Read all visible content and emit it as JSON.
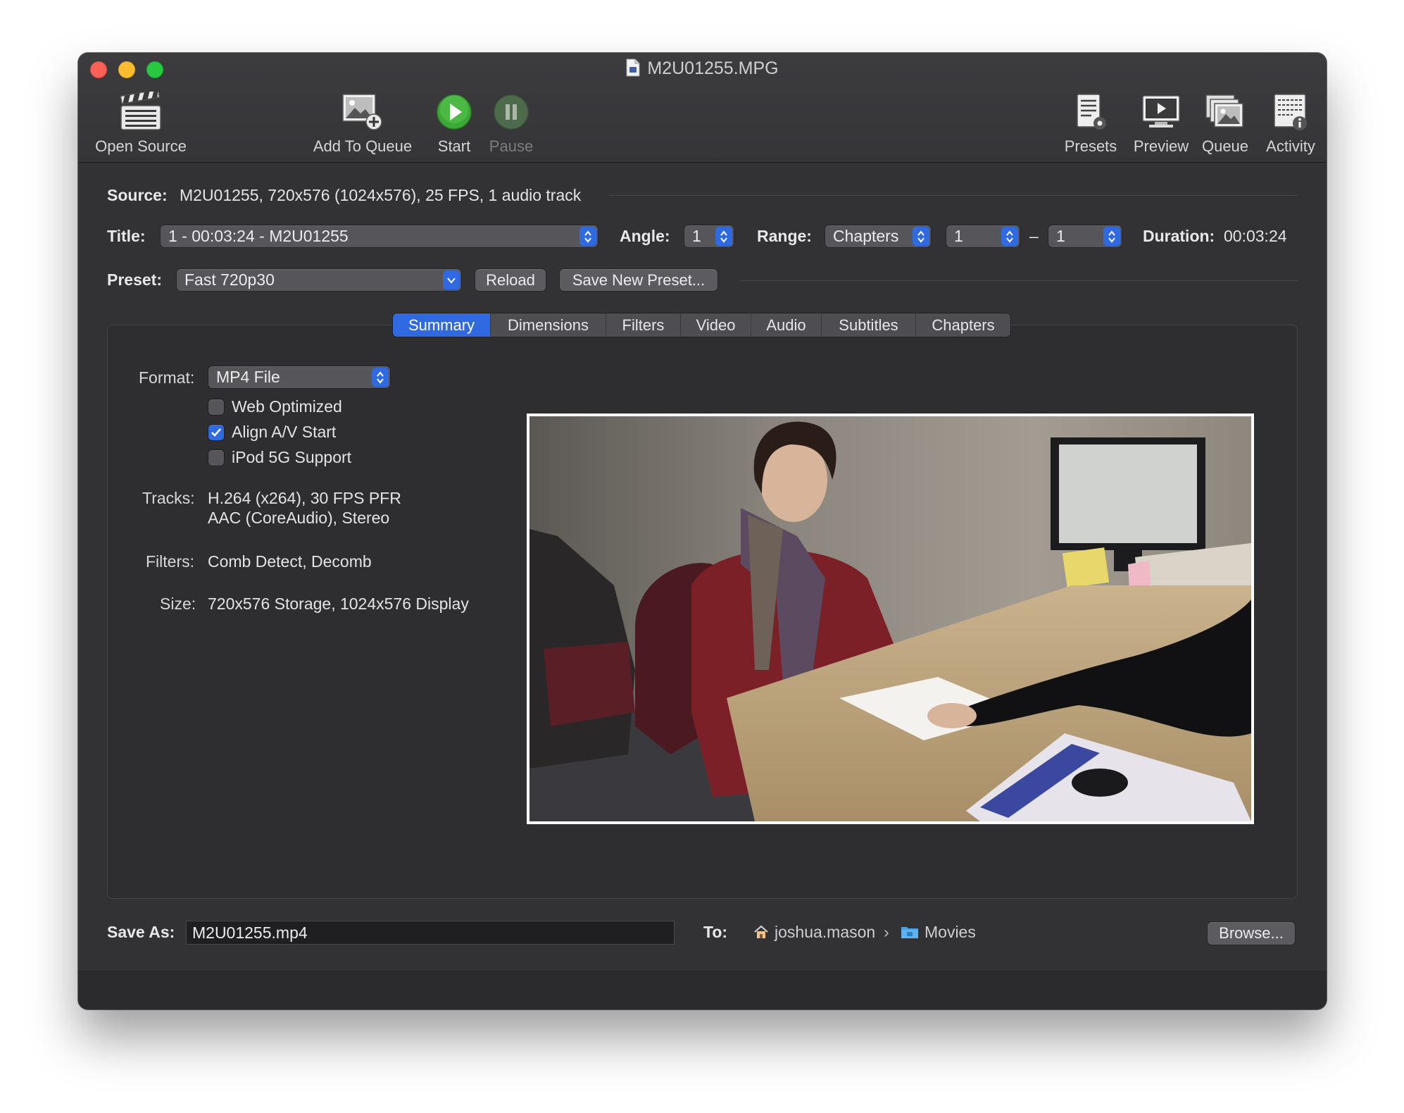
{
  "window": {
    "title": "M2U01255.MPG"
  },
  "toolbar": {
    "open_source": "Open Source",
    "add_to_queue": "Add To Queue",
    "start": "Start",
    "pause": "Pause",
    "presets": "Presets",
    "preview": "Preview",
    "queue": "Queue",
    "activity": "Activity"
  },
  "source": {
    "label": "Source:",
    "value": "M2U01255, 720x576 (1024x576), 25 FPS, 1 audio track"
  },
  "title_row": {
    "label": "Title:",
    "value": "1 - 00:03:24 - M2U01255",
    "angle_label": "Angle:",
    "angle_value": "1",
    "range_label": "Range:",
    "range_type": "Chapters",
    "range_start": "1",
    "range_dash": "–",
    "range_end": "1",
    "duration_label": "Duration:",
    "duration_value": "00:03:24"
  },
  "preset_row": {
    "label": "Preset:",
    "value": "Fast 720p30",
    "reload": "Reload",
    "save_new": "Save New Preset..."
  },
  "tabs": [
    {
      "label": "Summary",
      "active": true
    },
    {
      "label": "Dimensions",
      "active": false
    },
    {
      "label": "Filters",
      "active": false
    },
    {
      "label": "Video",
      "active": false
    },
    {
      "label": "Audio",
      "active": false
    },
    {
      "label": "Subtitles",
      "active": false
    },
    {
      "label": "Chapters",
      "active": false
    }
  ],
  "summary": {
    "format_label": "Format:",
    "format_value": "MP4 File",
    "web_optimized": {
      "label": "Web Optimized",
      "checked": false
    },
    "align_av": {
      "label": "Align A/V Start",
      "checked": true
    },
    "ipod": {
      "label": "iPod 5G Support",
      "checked": false
    },
    "tracks_label": "Tracks:",
    "tracks_line1": "H.264 (x264), 30 FPS PFR",
    "tracks_line2": "AAC (CoreAudio), Stereo",
    "filters_label": "Filters:",
    "filters_value": "Comb Detect, Decomb",
    "size_label": "Size:",
    "size_value": "720x576 Storage, 1024x576 Display"
  },
  "save": {
    "label": "Save As:",
    "filename": "M2U01255.mp4",
    "to_label": "To:",
    "path_home": "joshua.mason",
    "path_sep": "›",
    "path_folder": "Movies",
    "browse": "Browse..."
  },
  "colors": {
    "accent": "#2f6ae3",
    "window_bg": "#323235",
    "start_green": "#3aa935"
  }
}
